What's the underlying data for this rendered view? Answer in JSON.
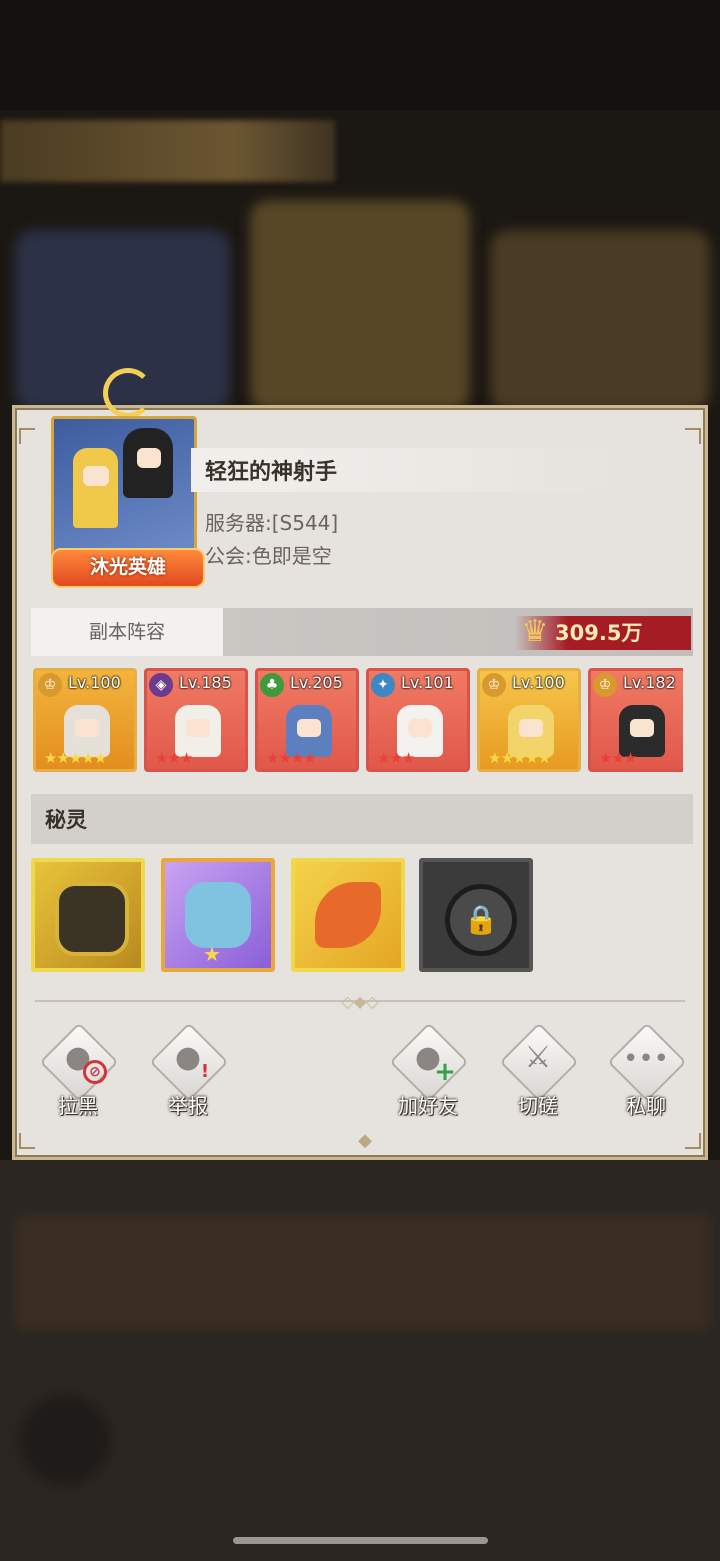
{
  "profile": {
    "badge": "沐光英雄",
    "player_name": "轻狂的神射手",
    "server": "服务器:[S544]",
    "guild": "公会:色即是空"
  },
  "lineup": {
    "label": "副本阵容",
    "power": "309.5万",
    "heroes": [
      {
        "level": "Lv.100",
        "faction_icon": "crown-icon",
        "faction_color": "#d89a2c",
        "stars": "★★★★★",
        "rarity": "gold"
      },
      {
        "level": "Lv.185",
        "faction_icon": "dark-icon",
        "faction_color": "#6b3b8c",
        "stars": "★★★",
        "rarity": "red"
      },
      {
        "level": "Lv.205",
        "faction_icon": "tree-icon",
        "faction_color": "#3f9a3b",
        "stars": "★★★★",
        "rarity": "red"
      },
      {
        "level": "Lv.101",
        "faction_icon": "water-icon",
        "faction_color": "#3c87c4",
        "stars": "★★★",
        "rarity": "red"
      },
      {
        "level": "Lv.100",
        "faction_icon": "crown-icon",
        "faction_color": "#d89a2c",
        "stars": "★★★★★",
        "rarity": "gold"
      },
      {
        "level": "Lv.182",
        "faction_icon": "crown-icon",
        "faction_color": "#d89a2c",
        "stars": "★★★",
        "rarity": "red"
      }
    ]
  },
  "spirits": {
    "label": "秘灵",
    "items": [
      {
        "name": "golden-knight-spirit",
        "stars": ""
      },
      {
        "name": "unicorn-dragon-spirit",
        "stars": "★"
      },
      {
        "name": "phoenix-spirit",
        "stars": ""
      },
      {
        "name": "locked-slot",
        "stars": ""
      }
    ]
  },
  "actions": {
    "block": "拉黑",
    "report": "举报",
    "add_friend": "加好友",
    "duel": "切磋",
    "chat": "私聊"
  },
  "colors": {
    "panel": "#e6e2dd",
    "power_banner": "#a61c24",
    "gold_frame": "#e7ad47",
    "red_frame": "#d8534c"
  }
}
